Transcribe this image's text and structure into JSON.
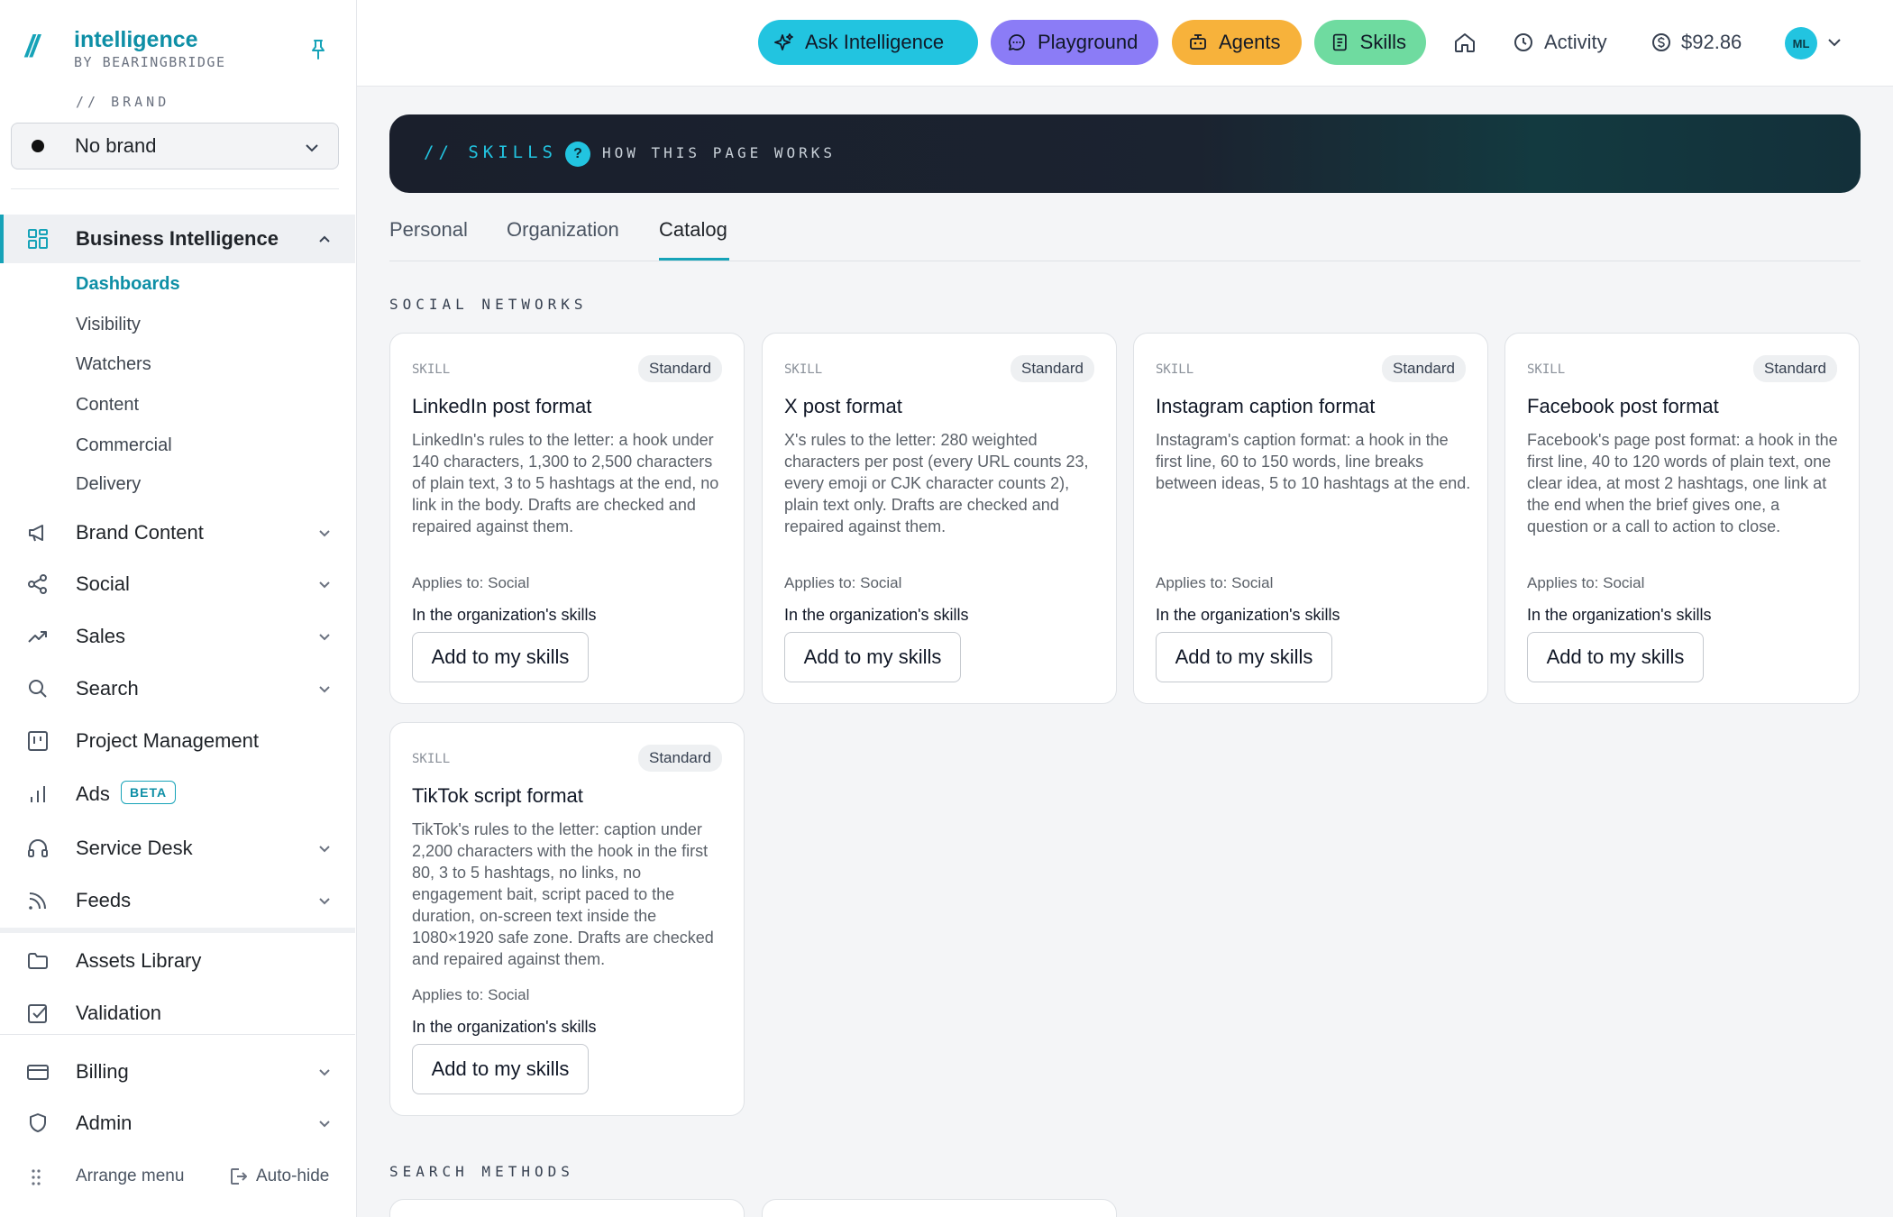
{
  "sidebar": {
    "logo_name": "intelligence",
    "logo_by": "BY BEARINGBRIDGE",
    "brand_label": "// BRAND",
    "brand_value": "No brand",
    "bi_label": "Business Intelligence",
    "bi_children": [
      "Dashboards",
      "Visibility",
      "Watchers",
      "Content",
      "Commercial",
      "Delivery"
    ],
    "brand_content": "Brand Content",
    "social": "Social",
    "sales": "Sales",
    "search": "Search",
    "project_management": "Project Management",
    "ads": "Ads",
    "ads_badge": "BETA",
    "service_desk": "Service Desk",
    "feeds": "Feeds",
    "assets_library": "Assets Library",
    "validation": "Validation",
    "billing": "Billing",
    "admin": "Admin",
    "arrange_menu": "Arrange menu",
    "auto_hide": "Auto-hide"
  },
  "topbar": {
    "ask": "Ask Intelligence",
    "playground": "Playground",
    "agents": "Agents",
    "skills": "Skills",
    "activity": "Activity",
    "balance": "$92.86",
    "avatar_initials": "ML"
  },
  "hero": {
    "title": "// SKILLS",
    "help_icon": "?",
    "how": "HOW THIS PAGE WORKS"
  },
  "tabs": [
    "Personal",
    "Organization",
    "Catalog"
  ],
  "active_tab": "Catalog",
  "sections": [
    {
      "label": "SOCIAL NETWORKS",
      "cards": [
        {
          "kind": "SKILL",
          "badge": "Standard",
          "title": "LinkedIn post format",
          "description": "LinkedIn's rules to the letter: a hook under 140 characters, 1,300 to 2,500 characters of plain text, 3 to 5 hashtags at the end, no link in the body. Drafts are checked and repaired against them.",
          "applies": "Applies to: Social",
          "status": "In the organization's skills",
          "action": "Add to my skills"
        },
        {
          "kind": "SKILL",
          "badge": "Standard",
          "title": "X post format",
          "description": "X's rules to the letter: 280 weighted characters per post (every URL counts 23, every emoji or CJK character counts 2), plain text only. Drafts are checked and repaired against them.",
          "applies": "Applies to: Social",
          "status": "In the organization's skills",
          "action": "Add to my skills"
        },
        {
          "kind": "SKILL",
          "badge": "Standard",
          "title": "Instagram caption format",
          "description": "Instagram's caption format: a hook in the first line, 60 to 150 words, line breaks between ideas, 5 to 10 hashtags at the end.",
          "applies": "Applies to: Social",
          "status": "In the organization's skills",
          "action": "Add to my skills"
        },
        {
          "kind": "SKILL",
          "badge": "Standard",
          "title": "Facebook post format",
          "description": "Facebook's page post format: a hook in the first line, 40 to 120 words of plain text, one clear idea, at most 2 hashtags, one link at the end when the brief gives one, a question or a call to action to close.",
          "applies": "Applies to: Social",
          "status": "In the organization's skills",
          "action": "Add to my skills"
        },
        {
          "kind": "SKILL",
          "badge": "Standard",
          "title": "TikTok script format",
          "description": "TikTok's rules to the letter: caption under 2,200 characters with the hook in the first 80, 3 to 5 hashtags, no links, no engagement bait, script paced to the duration, on-screen text inside the 1080×1920 safe zone. Drafts are checked and repaired against them.",
          "applies": "Applies to: Social",
          "status": "In the organization's skills",
          "action": "Add to my skills"
        }
      ]
    },
    {
      "label": "SEARCH METHODS",
      "cards": []
    }
  ],
  "colors": {
    "accent": "#16a3b8",
    "ask": "#22c4e0",
    "playground": "#8b7cf6",
    "agents": "#f7b23b",
    "skills": "#6fdba0"
  }
}
